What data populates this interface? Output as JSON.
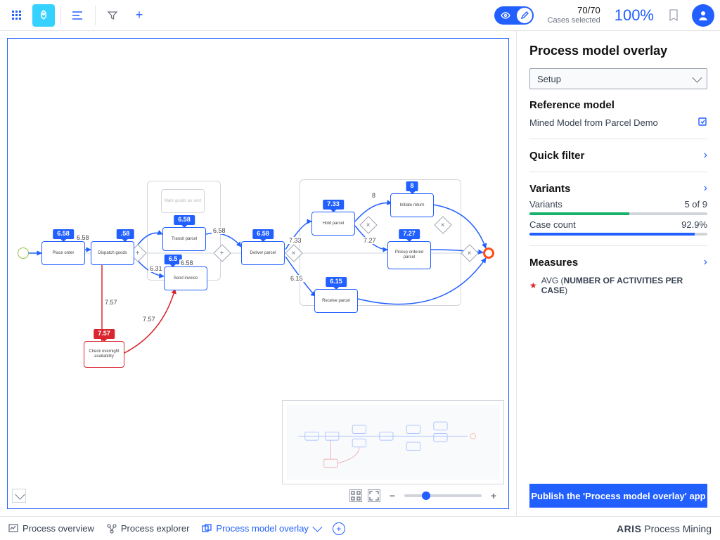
{
  "topbar": {
    "cases_count": "70/70",
    "cases_label": "Cases selected",
    "percent": "100%"
  },
  "panel": {
    "title": "Process model overlay",
    "setup_label": "Setup",
    "reference_title": "Reference model",
    "reference_value": "Mined Model from Parcel Demo",
    "quickfilter_title": "Quick filter",
    "variants_title": "Variants",
    "variants_label": "Variants",
    "variants_value": "5 of 9",
    "casecount_label": "Case count",
    "casecount_value": "92.9%",
    "measures_title": "Measures",
    "measure1_prefix": "AVG (",
    "measure1_name": "NUMBER OF ACTIVITIES PER CASE",
    "measure1_suffix": ")",
    "publish": "Publish the 'Process model overlay' app"
  },
  "footer": {
    "tab1": "Process overview",
    "tab2": "Process explorer",
    "tab3": "Process model overlay",
    "brand_bold": "ARIS",
    "brand_rest": " Process Mining"
  },
  "nodes": {
    "place_order": {
      "label": "Place order",
      "badge": "6.58"
    },
    "dispatch": {
      "label": "Dispatch goods",
      "badge": ".58"
    },
    "mark_goods": {
      "label": "Mark goods as sent",
      "badge": ""
    },
    "transit": {
      "label": "Transit parcel",
      "badge": "6.58"
    },
    "send_invoice": {
      "label": "Send invoice",
      "badge": "6.5"
    },
    "deliver": {
      "label": "Deliver parcel",
      "badge": "6.58"
    },
    "hold": {
      "label": "Hold parcel",
      "badge": "7.33"
    },
    "receive": {
      "label": "Receive parcel",
      "badge": "6.15"
    },
    "initiate": {
      "label": "Initiate return",
      "badge": "8"
    },
    "pickup": {
      "label": "Pickup ordered parcel",
      "badge": "7.27"
    },
    "check_over": {
      "label": "Check overnight availability",
      "badge": "7.57"
    }
  },
  "edges": {
    "e1": "6.58",
    "e2": "6.58",
    "e3": "6.31",
    "e4": "6.58",
    "e5": "6.58",
    "e6": "7.33",
    "e7": "7.27",
    "e8": "8",
    "e9": "6.15",
    "e10": "7.57",
    "e11": "7.57"
  }
}
